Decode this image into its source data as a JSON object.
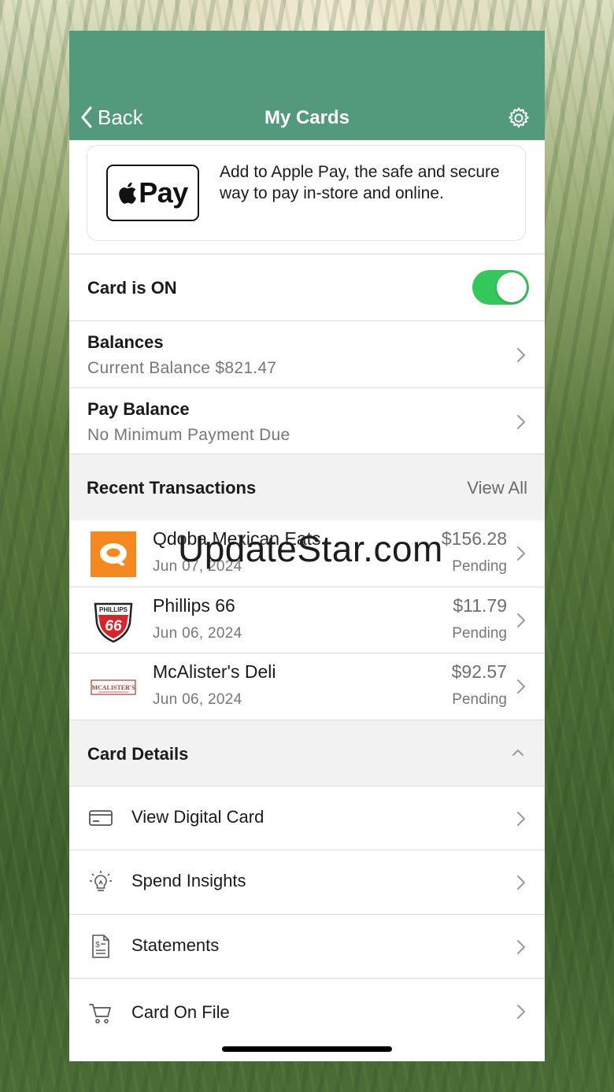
{
  "nav": {
    "back_label": "Back",
    "title": "My Cards",
    "settings_icon": "gear-icon"
  },
  "apple_pay": {
    "logo_text": "Pay",
    "description": "Add to Apple Pay, the safe and secure way to pay in-store and online."
  },
  "card_status": {
    "label": "Card is ON",
    "enabled": true
  },
  "balances": {
    "title": "Balances",
    "subtitle": "Current Balance $821.47"
  },
  "pay_balance": {
    "title": "Pay Balance",
    "subtitle": "No Minimum Payment Due"
  },
  "recent_transactions": {
    "header": "Recent Transactions",
    "view_all": "View All",
    "items": [
      {
        "merchant": "Qdoba Mexican Eats",
        "date": "Jun 07, 2024",
        "amount": "$156.28",
        "status": "Pending",
        "logo": "qdoba-logo"
      },
      {
        "merchant": "Phillips 66",
        "date": "Jun 06, 2024",
        "amount": "$11.79",
        "status": "Pending",
        "logo": "phillips66-logo"
      },
      {
        "merchant": "McAlister's Deli",
        "date": "Jun 06, 2024",
        "amount": "$92.57",
        "status": "Pending",
        "logo": "mcalisters-logo"
      }
    ]
  },
  "card_details": {
    "header": "Card Details",
    "items": [
      {
        "label": "View Digital Card",
        "icon": "credit-card-icon"
      },
      {
        "label": "Spend Insights",
        "icon": "lightbulb-icon"
      },
      {
        "label": "Statements",
        "icon": "statement-icon"
      },
      {
        "label": "Card On File",
        "icon": "cart-icon"
      }
    ]
  },
  "logos": {
    "phillips_top": "PHILLIPS",
    "phillips_num": "66",
    "mcalisters": "MCALISTER'S"
  },
  "watermark": "UpdateStar.com",
  "colors": {
    "header_green": "#529a7b",
    "toggle_green": "#34c759",
    "qdoba_orange": "#f5891f"
  }
}
